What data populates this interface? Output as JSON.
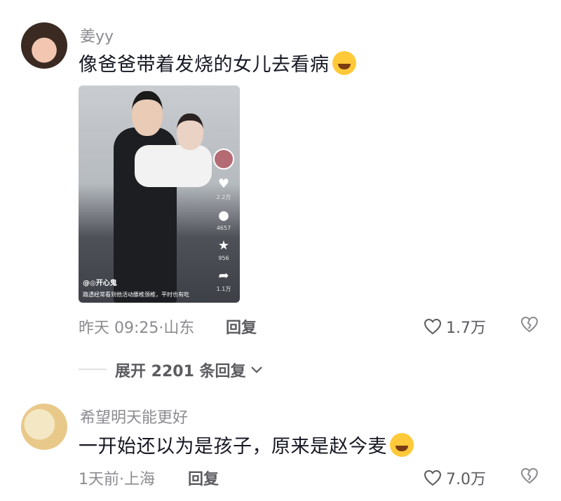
{
  "comments": [
    {
      "username": "姜yy",
      "text": "像爸爸带着发烧的女儿去看病",
      "emoji": "rolling-on-floor-laughing",
      "time": "昨天 09:25",
      "location": "山东",
      "reply_label": "回复",
      "likes": "1.7万",
      "video": {
        "author": "@◎开心鬼",
        "caption": "路透经常看到他活动腰椎颈椎，平时也有吃",
        "side_counts": [
          "2.2万",
          "4657",
          "956",
          "1.1万"
        ]
      }
    },
    {
      "username": "希望明天能更好",
      "text": "一开始还以为是孩子，原来是赵今麦",
      "emoji": "rolling-on-floor-laughing",
      "time": "1天前",
      "location": "上海",
      "reply_label": "回复",
      "likes": "7.0万"
    }
  ],
  "expand_replies": {
    "label": "展开 2201 条回复"
  },
  "colors": {
    "text": "#161823",
    "secondary": "#8b8b90",
    "emoji": "#ffc93a"
  }
}
